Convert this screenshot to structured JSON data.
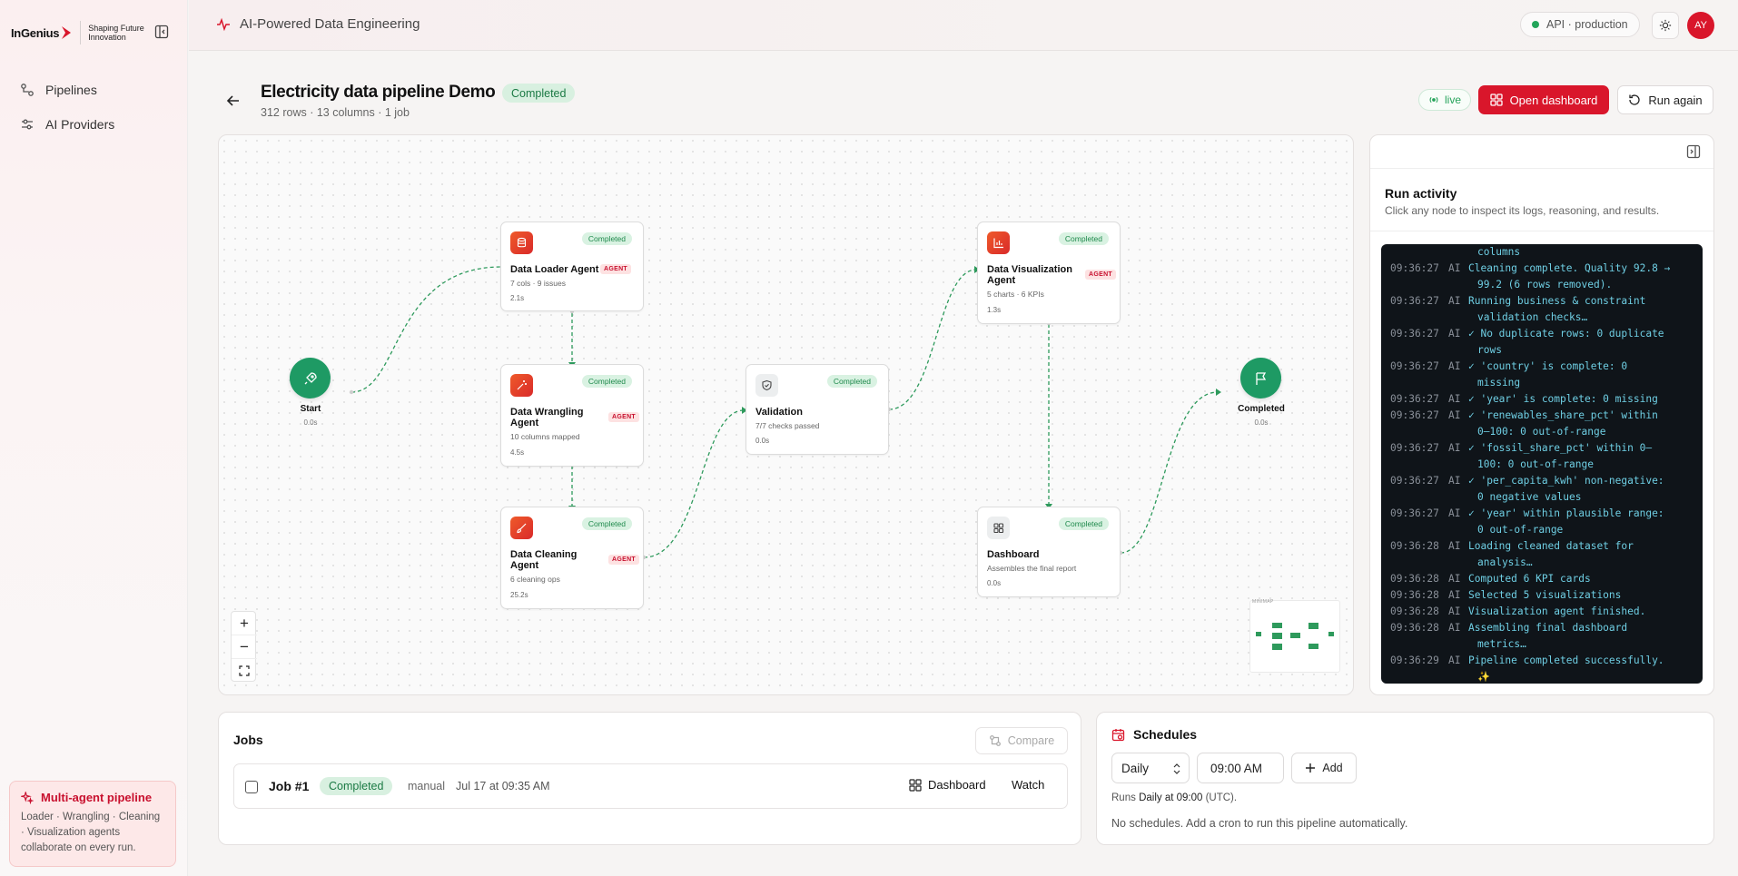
{
  "brand": {
    "wordmark": "InGenius",
    "tagline": "Shaping Future Innovation"
  },
  "sidebar": {
    "items": [
      {
        "label": "Pipelines",
        "icon": "workflow-icon"
      },
      {
        "label": "AI Providers",
        "icon": "sliders-icon"
      }
    ],
    "promo": {
      "title": "Multi-agent pipeline",
      "body": "Loader · Wrangling · Cleaning · Visualization agents collaborate on every run."
    }
  },
  "topbar": {
    "title": "AI-Powered Data Engineering",
    "api_status": "API · production",
    "avatar_initials": "AY"
  },
  "page": {
    "title": "Electricity data pipeline Demo",
    "status": "Completed",
    "subtitle": "312 rows · 13 columns · 1 job",
    "live_label": "live",
    "open_dashboard": "Open dashboard",
    "run_again": "Run again"
  },
  "pipeline": {
    "start": {
      "label": "Start",
      "time": "0.0s"
    },
    "end": {
      "label": "Completed",
      "time": "0.0s"
    },
    "agent_tag": "AGENT",
    "nodes": [
      {
        "title": "Data Loader Agent",
        "status": "Completed",
        "meta": "7 cols · 9 issues",
        "time": "2.1s",
        "agent": true
      },
      {
        "title": "Data Wrangling Agent",
        "status": "Completed",
        "meta": "10 columns mapped",
        "time": "4.5s",
        "agent": true
      },
      {
        "title": "Data Cleaning Agent",
        "status": "Completed",
        "meta": "6 cleaning ops",
        "time": "25.2s",
        "agent": true
      },
      {
        "title": "Validation",
        "status": "Completed",
        "meta": "7/7 checks passed",
        "time": "0.0s",
        "agent": false
      },
      {
        "title": "Data Visualization Agent",
        "status": "Completed",
        "meta": "5 charts · 6 KPIs",
        "time": "1.3s",
        "agent": true
      },
      {
        "title": "Dashboard",
        "status": "Completed",
        "meta": "Assembles the final report",
        "time": "0.0s",
        "agent": false
      }
    ],
    "zoom_in": "+",
    "zoom_out": "−",
    "fit_view": "⛶",
    "minimap_label": "MINIMAP"
  },
  "activity": {
    "title": "Run activity",
    "subtitle": "Click any node to inspect its logs, reasoning, and results.",
    "logs": [
      {
        "ts": "",
        "src": "",
        "msg": "",
        "cont": "columns"
      },
      {
        "ts": "09:36:27",
        "src": "AI",
        "msg": "Cleaning complete. Quality 92.8 →",
        "cont": "99.2 (6 rows removed)."
      },
      {
        "ts": "09:36:27",
        "src": "AI",
        "msg": "Running business & constraint",
        "cont": "validation checks…"
      },
      {
        "ts": "09:36:27",
        "src": "AI",
        "msg": "✓ No duplicate rows: 0 duplicate",
        "cont": "rows"
      },
      {
        "ts": "09:36:27",
        "src": "AI",
        "msg": "✓ 'country' is complete: 0",
        "cont": "missing"
      },
      {
        "ts": "09:36:27",
        "src": "AI",
        "msg": "✓ 'year' is complete: 0 missing",
        "cont": ""
      },
      {
        "ts": "09:36:27",
        "src": "AI",
        "msg": "✓ 'renewables_share_pct' within",
        "cont": "0–100: 0 out-of-range"
      },
      {
        "ts": "09:36:27",
        "src": "AI",
        "msg": "✓ 'fossil_share_pct' within 0–",
        "cont": "100: 0 out-of-range"
      },
      {
        "ts": "09:36:27",
        "src": "AI",
        "msg": "✓ 'per_capita_kwh' non-negative:",
        "cont": "0 negative values"
      },
      {
        "ts": "09:36:27",
        "src": "AI",
        "msg": "✓ 'year' within plausible range:",
        "cont": "0 out-of-range"
      },
      {
        "ts": "09:36:28",
        "src": "AI",
        "msg": "Loading cleaned dataset for",
        "cont": "analysis…"
      },
      {
        "ts": "09:36:28",
        "src": "AI",
        "msg": "Computed 6 KPI cards",
        "cont": ""
      },
      {
        "ts": "09:36:28",
        "src": "AI",
        "msg": "Selected 5 visualizations",
        "cont": ""
      },
      {
        "ts": "09:36:28",
        "src": "AI",
        "msg": "Visualization agent finished.",
        "cont": ""
      },
      {
        "ts": "09:36:28",
        "src": "AI",
        "msg": "Assembling final dashboard",
        "cont": "metrics…"
      },
      {
        "ts": "09:36:29",
        "src": "AI",
        "msg": "Pipeline completed successfully.",
        "cont": "✨"
      }
    ]
  },
  "jobs": {
    "title": "Jobs",
    "compare": "Compare",
    "rows": [
      {
        "name": "Job #1",
        "status": "Completed",
        "trigger": "manual",
        "date": "Jul 17 at 09:35 AM",
        "dashboard": "Dashboard",
        "watch": "Watch"
      }
    ]
  },
  "schedules": {
    "title": "Schedules",
    "frequency": "Daily",
    "time": "09:00 AM",
    "add": "Add",
    "runs_prefix": "Runs",
    "runs_value": "Daily at 09:00",
    "runs_suffix": "(UTC).",
    "empty": "No schedules. Add a cron to run this pipeline automatically."
  },
  "colors": {
    "brand_red": "#d9162b",
    "success_green": "#1e9a64",
    "terminal_bg": "#0f1419"
  }
}
